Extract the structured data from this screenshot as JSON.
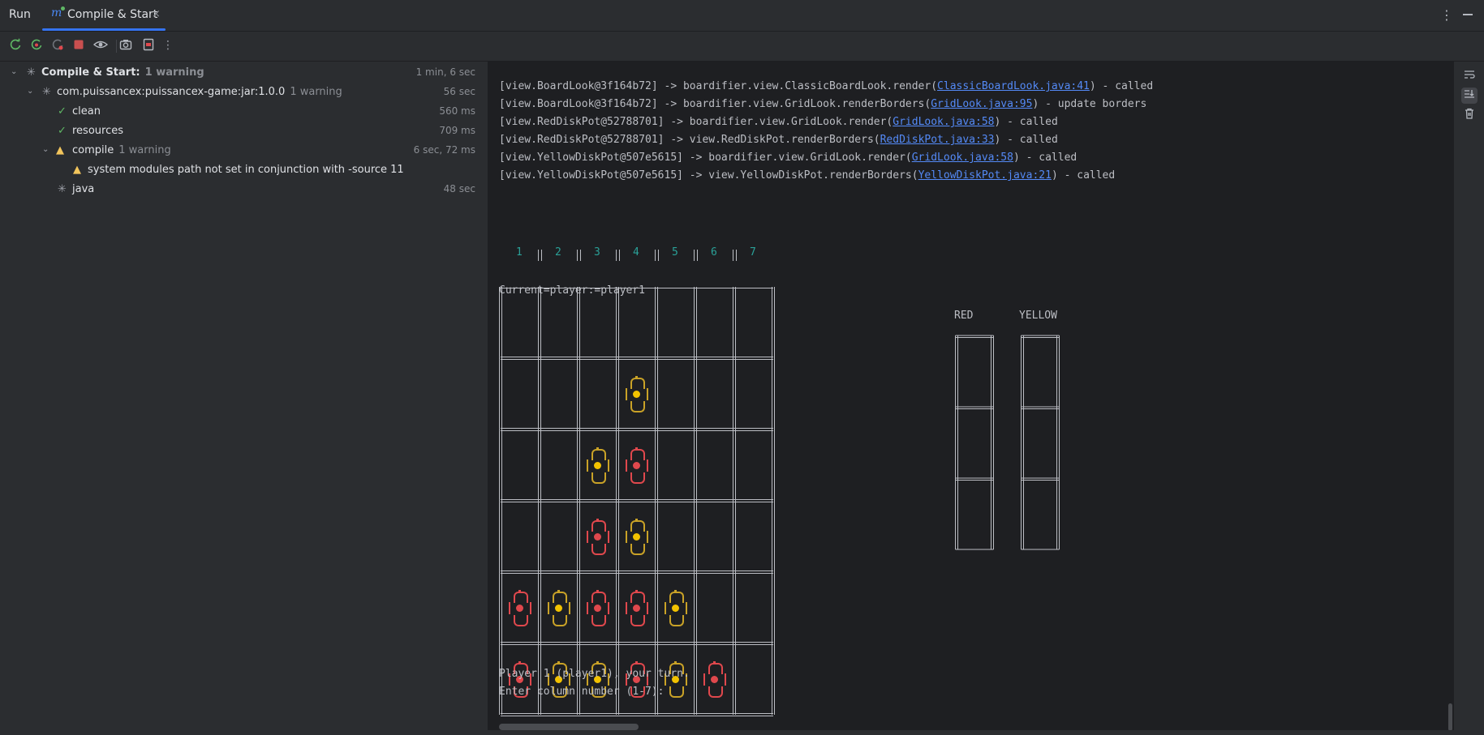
{
  "header": {
    "run_label": "Run",
    "tab_title": "Compile & Start",
    "tab_icon": "maven-icon",
    "close_glyph": "×",
    "more_glyph": "⋮"
  },
  "toolbar": {
    "buttons": [
      "rerun-icon",
      "rerun-failed-icon",
      "rerun-disabled-icon",
      "stop-icon",
      "eye-icon",
      "camera-icon",
      "export-icon",
      "more-icon"
    ]
  },
  "tree": {
    "root": {
      "label": "Compile & Start:",
      "note": "1 warning",
      "time": "1 min, 6 sec"
    },
    "project": {
      "label": "com.puissancex:puissancex-game:jar:1.0.0",
      "note": "1 warning",
      "time": "56 sec"
    },
    "clean": {
      "label": "clean",
      "time": "560 ms"
    },
    "resources": {
      "label": "resources",
      "time": "709 ms"
    },
    "compile": {
      "label": "compile",
      "note": "1 warning",
      "time": "6 sec, 72 ms"
    },
    "warning": {
      "label": "system modules path not set in conjunction with -source 11"
    },
    "java": {
      "label": "java",
      "time": "48 sec"
    }
  },
  "console": {
    "log": [
      {
        "pre": "[view.BoardLook@3f164b72] -> boardifier.view.ClassicBoardLook.render(",
        "link": "ClassicBoardLook.java:41",
        "post": ") - called"
      },
      {
        "pre": "[view.BoardLook@3f164b72] -> boardifier.view.GridLook.renderBorders(",
        "link": "GridLook.java:95",
        "post": ") - update borders"
      },
      {
        "pre": "[view.RedDiskPot@52788701] -> boardifier.view.GridLook.render(",
        "link": "GridLook.java:58",
        "post": ") - called"
      },
      {
        "pre": "[view.RedDiskPot@52788701] -> view.RedDiskPot.renderBorders(",
        "link": "RedDiskPot.java:33",
        "post": ") - called"
      },
      {
        "pre": "[view.YellowDiskPot@507e5615] -> boardifier.view.GridLook.render(",
        "link": "GridLook.java:58",
        "post": ") - called"
      },
      {
        "pre": "[view.YellowDiskPot@507e5615] -> view.YellowDiskPot.renderBorders(",
        "link": "YellowDiskPot.java:21",
        "post": ") - called"
      }
    ],
    "column_numbers": [
      "1",
      "2",
      "3",
      "4",
      "5",
      "6",
      "7"
    ],
    "current_player": "Current=player:=player1",
    "board": {
      "rows": 6,
      "cols": 7,
      "disks": [
        {
          "row": 1,
          "col": 3,
          "color": "yellow"
        },
        {
          "row": 2,
          "col": 2,
          "color": "yellow"
        },
        {
          "row": 2,
          "col": 3,
          "color": "red"
        },
        {
          "row": 3,
          "col": 2,
          "color": "red"
        },
        {
          "row": 3,
          "col": 3,
          "color": "yellow"
        },
        {
          "row": 4,
          "col": 0,
          "color": "red"
        },
        {
          "row": 4,
          "col": 1,
          "color": "yellow"
        },
        {
          "row": 4,
          "col": 2,
          "color": "red"
        },
        {
          "row": 4,
          "col": 3,
          "color": "red"
        },
        {
          "row": 4,
          "col": 4,
          "color": "yellow"
        },
        {
          "row": 5,
          "col": 0,
          "color": "red"
        },
        {
          "row": 5,
          "col": 1,
          "color": "yellow"
        },
        {
          "row": 5,
          "col": 2,
          "color": "yellow"
        },
        {
          "row": 5,
          "col": 3,
          "color": "red"
        },
        {
          "row": 5,
          "col": 4,
          "color": "yellow"
        },
        {
          "row": 5,
          "col": 5,
          "color": "red"
        }
      ]
    },
    "pots": {
      "red_label": "RED",
      "yellow_label": "YELLOW",
      "slots": 3
    },
    "prompt_turn": "Player 1 (player1), your turn.",
    "prompt_input": "Enter column number (1-7):"
  },
  "colors": {
    "red_disk": "#e0484d",
    "yellow_disk": "#f2c200",
    "accent": "#3574f0",
    "link": "#548af7"
  }
}
